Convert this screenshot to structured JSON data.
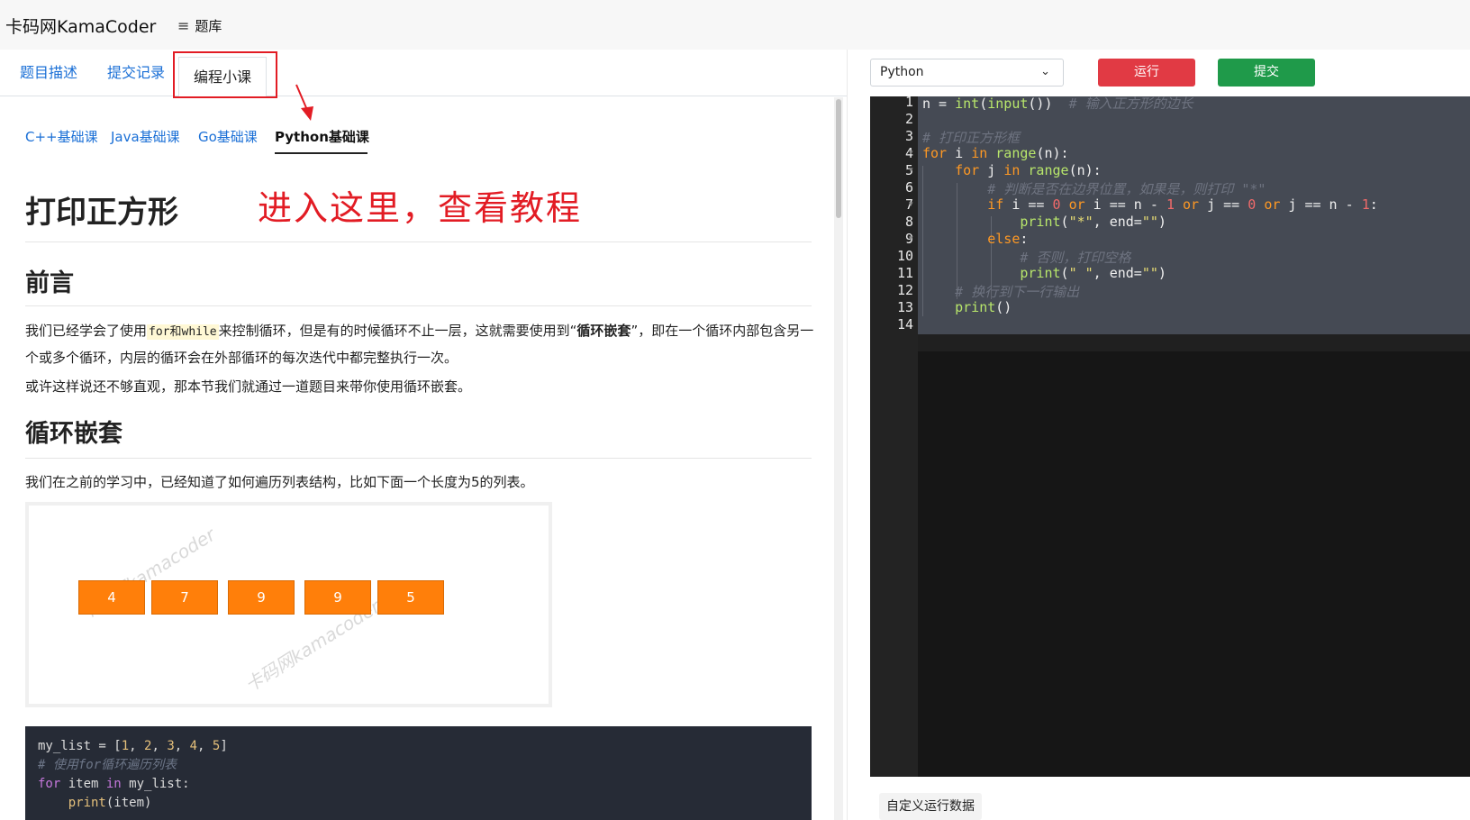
{
  "nav": {
    "brand": "卡码网KamaCoder",
    "menu_icon": "≡",
    "problem_bank": "题库"
  },
  "tabs": {
    "description": "题目描述",
    "records": "提交记录",
    "lesson": "编程小课"
  },
  "annotation": {
    "arrow_color": "#e21c24",
    "text": "进入这里，查看教程"
  },
  "subtabs": {
    "cpp": "C++基础课",
    "java": "Java基础课",
    "go": "Go基础课",
    "python": "Python基础课"
  },
  "article": {
    "title": "打印正方形",
    "intro_heading": "前言",
    "p1_a": "我们已经学会了使用",
    "p1_code": "for和while",
    "p1_b": "来控制循环，但是有的时候循环不止一层，这就需要使用到“",
    "p1_strong": "循环嵌套",
    "p1_c": "”，即在一个循环内部包含另一个或多个循环，内层的循环会在外部循环的每次迭代中都完整执行一次。",
    "p2": "或许这样说还不够直观，那本节我们就通过一道题目来带你使用循环嵌套。",
    "loop_heading": "循环嵌套",
    "p3": "我们在之前的学习中，已经知道了如何遍历列表结构，比如下面一个长度为5的列表。",
    "diagram": {
      "cells": [
        "4",
        "7",
        "9",
        "9",
        "5"
      ],
      "watermark": "卡码网kamacoder",
      "cell_color": "#ff7f0a"
    },
    "code": {
      "l1_var": "my_list = [",
      "l1_nums": [
        "1",
        "2",
        "3",
        "4",
        "5"
      ],
      "l2_comment": "# 使用for循环遍历列表",
      "l3_for": "for",
      "l3_mid": " item ",
      "l3_in": "in",
      "l3_end": " my_list:",
      "l4_fn": "print",
      "l4_arg": "(item)"
    }
  },
  "editor": {
    "language": "Python",
    "run_label": "运行",
    "submit_label": "提交",
    "line_numbers": [
      "1",
      "2",
      "3",
      "4",
      "5",
      "6",
      "7",
      "8",
      "9",
      "10",
      "11",
      "12",
      "13",
      "14"
    ],
    "comments": {
      "c1": "# 输入正方形的边长",
      "c3": "# 打印正方形框",
      "c6": "# 判断是否在边界位置，如果是，则打印 \"*\"",
      "c10": "# 否则，打印空格",
      "c12": "# 换行到下一行输出"
    },
    "strings": {
      "star": "\"*\"",
      "empty": "\"\"",
      "space": "\" \""
    },
    "custom_data_label": "自定义运行数据",
    "colors": {
      "run": "#e13a44",
      "submit": "#1f9a4a"
    }
  }
}
